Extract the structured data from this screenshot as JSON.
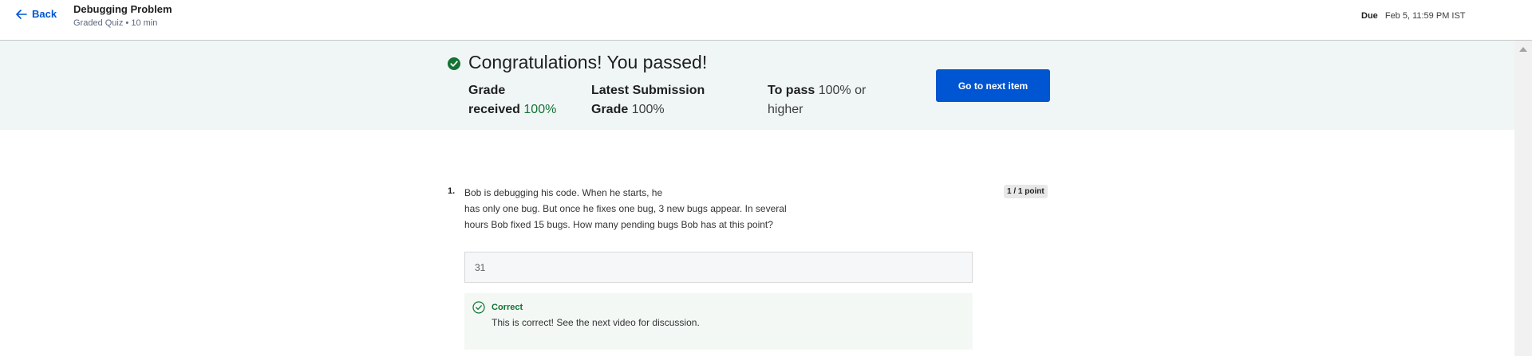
{
  "header": {
    "back_label": "Back",
    "item_title": "Debugging Problem",
    "item_subtitle": "Graded Quiz • 10 min",
    "due_label": "Due",
    "due_date": "Feb 5, 11:59 PM IST"
  },
  "banner": {
    "heading": "Congratulations! You passed!",
    "grade_received": {
      "label_line1": "Grade",
      "label_line2": "received",
      "value": "100%"
    },
    "latest_submission": {
      "label_line1": "Latest Submission",
      "label_line2": "Grade",
      "value": "100%"
    },
    "to_pass": {
      "label": "To pass",
      "value_line1": "100% or",
      "value_line2": "higher"
    },
    "next_button_label": "Go to next item",
    "accent_color": "#0056d2",
    "success_color": "#137333"
  },
  "question": {
    "number": "1.",
    "text_lines": [
      "Bob is debugging his code. When he starts, he",
      "has only one bug. But once he fixes one bug, 3 new bugs appear. In several",
      "hours Bob fixed 15 bugs. How many pending bugs Bob has at this point?"
    ],
    "points": "1 / 1 point",
    "answer_value": "31",
    "feedback": {
      "status": "Correct",
      "message": "This is correct! See the next video for discussion."
    }
  },
  "icons": {
    "back": "arrow-left-icon",
    "pass": "check-circle-filled-icon",
    "feedback": "check-circle-outline-icon",
    "scroll": "scroll-up-arrow-icon"
  }
}
